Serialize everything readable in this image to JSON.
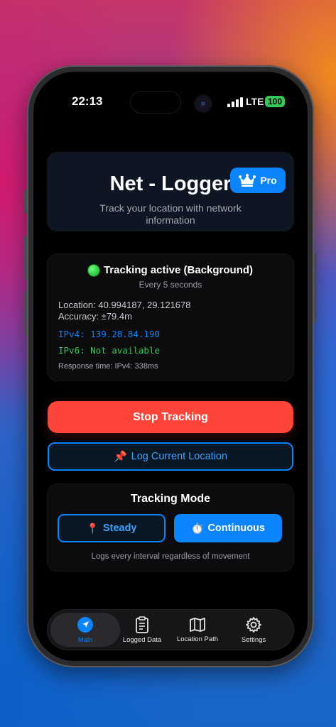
{
  "status_bar": {
    "time": "22:13",
    "network": "LTE",
    "battery": "100"
  },
  "header": {
    "title": "Net - Logger",
    "badge_icon": "crown-icon",
    "badge_label": "Pro",
    "subtitle": "Track your location with network information"
  },
  "tracking": {
    "status": "Tracking active (Background)",
    "interval": "Every 5 seconds",
    "location": "Location: 40.994187, 29.121678",
    "accuracy": "Accuracy: ±79.4m",
    "ipv4": "IPv4: 139.28.84.190",
    "ipv6": "IPv6: Not available",
    "response_time": "Response time: IPv4: 338ms",
    "colors": {
      "ipv4": "#0a84ff",
      "ipv6": "#34c759",
      "active_dot": "#13a82a"
    }
  },
  "actions": {
    "stop_label": "Stop Tracking",
    "log_label": "Log Current Location",
    "log_icon": "pushpin-icon"
  },
  "mode": {
    "title": "Tracking Mode",
    "steady_label": "Steady",
    "steady_icon": "round-pushpin-icon",
    "continuous_label": "Continuous",
    "continuous_icon": "stopwatch-icon",
    "selected": "Continuous",
    "description": "Logs every interval regardless of movement"
  },
  "tabs": [
    {
      "label": "Main",
      "icon": "navigation-arrow-icon",
      "active": true
    },
    {
      "label": "Logged Data",
      "icon": "clipboard-icon",
      "active": false
    },
    {
      "label": "Location Path",
      "icon": "map-icon",
      "active": false
    },
    {
      "label": "Settings",
      "icon": "gear-icon",
      "active": false
    }
  ],
  "colors": {
    "accent": "#0a84ff",
    "danger": "#ff453a",
    "success": "#34c759"
  }
}
